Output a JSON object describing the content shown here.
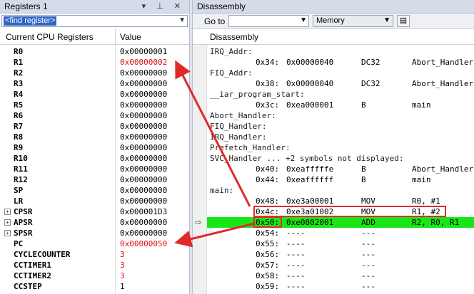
{
  "registers_pane": {
    "title": "Registers 1",
    "title_icons": "▾ ⊥ ✕",
    "find_placeholder": "<find register>",
    "columns": [
      "Current CPU Registers",
      "Value"
    ],
    "rows": [
      {
        "name": "R0",
        "value": "0x00000001",
        "changed": false,
        "expandable": false
      },
      {
        "name": "R1",
        "value": "0x00000002",
        "changed": true,
        "expandable": false
      },
      {
        "name": "R2",
        "value": "0x00000000",
        "changed": false,
        "expandable": false
      },
      {
        "name": "R3",
        "value": "0x00000000",
        "changed": false,
        "expandable": false
      },
      {
        "name": "R4",
        "value": "0x00000000",
        "changed": false,
        "expandable": false
      },
      {
        "name": "R5",
        "value": "0x00000000",
        "changed": false,
        "expandable": false
      },
      {
        "name": "R6",
        "value": "0x00000000",
        "changed": false,
        "expandable": false
      },
      {
        "name": "R7",
        "value": "0x00000000",
        "changed": false,
        "expandable": false
      },
      {
        "name": "R8",
        "value": "0x00000000",
        "changed": false,
        "expandable": false
      },
      {
        "name": "R9",
        "value": "0x00000000",
        "changed": false,
        "expandable": false
      },
      {
        "name": "R10",
        "value": "0x00000000",
        "changed": false,
        "expandable": false
      },
      {
        "name": "R11",
        "value": "0x00000000",
        "changed": false,
        "expandable": false
      },
      {
        "name": "R12",
        "value": "0x00000000",
        "changed": false,
        "expandable": false
      },
      {
        "name": "SP",
        "value": "0x00000000",
        "changed": false,
        "expandable": false
      },
      {
        "name": "LR",
        "value": "0x00000000",
        "changed": false,
        "expandable": false
      },
      {
        "name": "CPSR",
        "value": "0x000001D3",
        "changed": false,
        "expandable": true
      },
      {
        "name": "APSR",
        "value": "0x00000000",
        "changed": false,
        "expandable": true
      },
      {
        "name": "SPSR",
        "value": "0x00000000",
        "changed": false,
        "expandable": true
      },
      {
        "name": "PC",
        "value": "0x00000050",
        "changed": true,
        "expandable": false
      },
      {
        "name": "CYCLECOUNTER",
        "value": "3",
        "changed": true,
        "expandable": false
      },
      {
        "name": "CCTIMER1",
        "value": "3",
        "changed": true,
        "expandable": false
      },
      {
        "name": "CCTIMER2",
        "value": "3",
        "changed": true,
        "expandable": false
      },
      {
        "name": "CCSTEP",
        "value": "1",
        "changed": false,
        "expandable": false
      }
    ]
  },
  "disassembly_pane": {
    "title": "Disassembly",
    "goto_label": "Go to",
    "goto_value": "",
    "memory_select": "Memory",
    "header": "Disassembly",
    "lines": [
      {
        "label": "IRQ_Addr:",
        "addr": "",
        "code": "",
        "mnemonic": "",
        "operands": "",
        "current": false
      },
      {
        "label": "",
        "addr": "0x34:",
        "code": "0x00000040",
        "mnemonic": "DC32",
        "operands": "Abort_Handler",
        "current": false
      },
      {
        "label": "FIQ_Addr:",
        "addr": "",
        "code": "",
        "mnemonic": "",
        "operands": "",
        "current": false
      },
      {
        "label": "",
        "addr": "0x38:",
        "code": "0x00000040",
        "mnemonic": "DC32",
        "operands": "Abort_Handler",
        "current": false
      },
      {
        "label": "__iar_program_start:",
        "addr": "",
        "code": "",
        "mnemonic": "",
        "operands": "",
        "current": false
      },
      {
        "label": "",
        "addr": "0x3c:",
        "code": "0xea000001",
        "mnemonic": "B",
        "operands": "main",
        "current": false
      },
      {
        "label": "Abort_Handler:",
        "addr": "",
        "code": "",
        "mnemonic": "",
        "operands": "",
        "current": false
      },
      {
        "label": "FIQ_Handler:",
        "addr": "",
        "code": "",
        "mnemonic": "",
        "operands": "",
        "current": false
      },
      {
        "label": "IRQ_Handler:",
        "addr": "",
        "code": "",
        "mnemonic": "",
        "operands": "",
        "current": false
      },
      {
        "label": "Prefetch_Handler:",
        "addr": "",
        "code": "",
        "mnemonic": "",
        "operands": "",
        "current": false
      },
      {
        "label": "SVC_Handler ... +2 symbols not displayed:",
        "addr": "",
        "code": "",
        "mnemonic": "",
        "operands": "",
        "current": false
      },
      {
        "label": "",
        "addr": "0x40:",
        "code": "0xeafffffe",
        "mnemonic": "B",
        "operands": "Abort_Handler",
        "current": false
      },
      {
        "label": "",
        "addr": "0x44:",
        "code": "0xeaffffff",
        "mnemonic": "B",
        "operands": "main",
        "current": false
      },
      {
        "label": "main:",
        "addr": "",
        "code": "",
        "mnemonic": "",
        "operands": "",
        "current": false
      },
      {
        "label": "",
        "addr": "0x48:",
        "code": "0xe3a00001",
        "mnemonic": "MOV",
        "operands": "R0, #1",
        "current": false
      },
      {
        "label": "",
        "addr": "0x4c:",
        "code": "0xe3a01002",
        "mnemonic": "MOV",
        "operands": "R1, #2",
        "current": false
      },
      {
        "label": "",
        "addr": "0x50:",
        "code": "0xe0802001",
        "mnemonic": "ADD",
        "operands": "R2, R0, R1",
        "current": true
      },
      {
        "label": "",
        "addr": "0x54:",
        "code": "----",
        "mnemonic": "---",
        "operands": "",
        "current": false
      },
      {
        "label": "",
        "addr": "0x55:",
        "code": "----",
        "mnemonic": "---",
        "operands": "",
        "current": false
      },
      {
        "label": "",
        "addr": "0x56:",
        "code": "----",
        "mnemonic": "---",
        "operands": "",
        "current": false
      },
      {
        "label": "",
        "addr": "0x57:",
        "code": "----",
        "mnemonic": "---",
        "operands": "",
        "current": false
      },
      {
        "label": "",
        "addr": "0x58:",
        "code": "----",
        "mnemonic": "---",
        "operands": "",
        "current": false
      },
      {
        "label": "",
        "addr": "0x59:",
        "code": "----",
        "mnemonic": "---",
        "operands": "",
        "current": false
      }
    ]
  },
  "colors": {
    "changed_value": "#e01010",
    "current_line": "#19e619",
    "annotation_red": "#e02a2a"
  }
}
